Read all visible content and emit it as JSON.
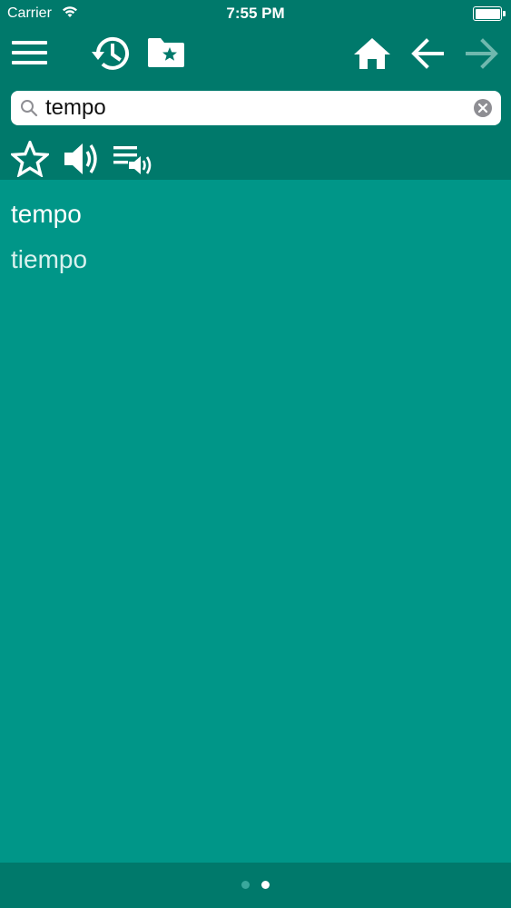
{
  "status_bar": {
    "carrier": "Carrier",
    "time": "7:55 PM"
  },
  "toolbar": {
    "icons": [
      "menu-icon",
      "history-icon",
      "favorites-folder-icon",
      "home-icon",
      "back-arrow-icon",
      "forward-arrow-icon"
    ]
  },
  "search": {
    "value": "tempo",
    "placeholder": ""
  },
  "actions": {
    "icons": [
      "star-icon",
      "speaker-icon",
      "playlist-audio-icon"
    ]
  },
  "results": [
    {
      "text": "tempo"
    },
    {
      "text": "tiempo"
    }
  ],
  "pager": {
    "total": 2,
    "current": 2
  },
  "colors": {
    "header": "#00796b",
    "content": "#009688",
    "text": "#ffffff"
  }
}
